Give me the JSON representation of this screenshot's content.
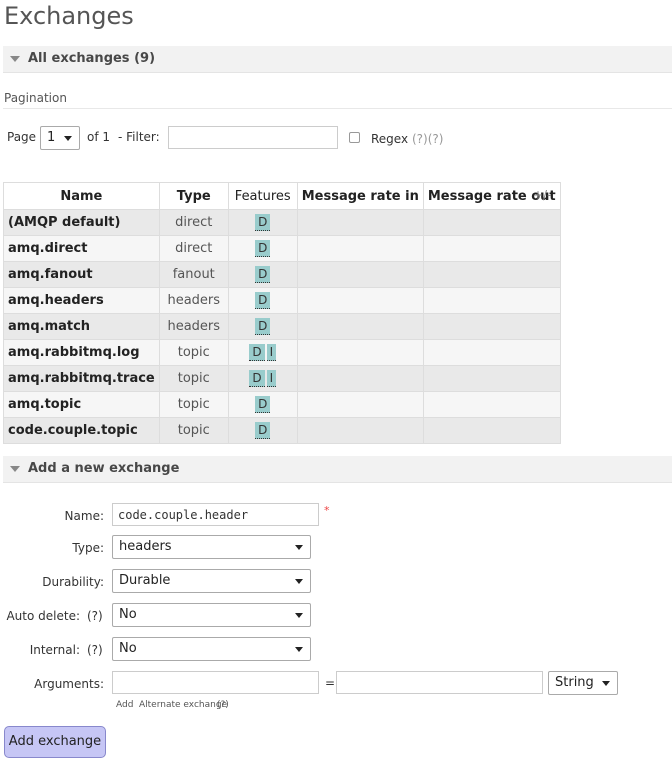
{
  "page_title": "Exchanges",
  "all_exchanges": {
    "label": "All exchanges (9)"
  },
  "pagination": {
    "label": "Pagination",
    "page_label": "Page",
    "page_value": "1",
    "of_label": "of 1",
    "filter_label": "- Filter:",
    "filter_value": "",
    "regex_label": "Regex",
    "regex_help": "(?)(?)",
    "regex_checked": false
  },
  "table": {
    "headers": [
      "Name",
      "Type",
      "Features",
      "Message rate in",
      "Message rate out"
    ],
    "column_toggle": "+/-",
    "rows": [
      {
        "name": "(AMQP default)",
        "type": "direct",
        "features": [
          "D"
        ],
        "rate_in": "",
        "rate_out": ""
      },
      {
        "name": "amq.direct",
        "type": "direct",
        "features": [
          "D"
        ],
        "rate_in": "",
        "rate_out": ""
      },
      {
        "name": "amq.fanout",
        "type": "fanout",
        "features": [
          "D"
        ],
        "rate_in": "",
        "rate_out": ""
      },
      {
        "name": "amq.headers",
        "type": "headers",
        "features": [
          "D"
        ],
        "rate_in": "",
        "rate_out": ""
      },
      {
        "name": "amq.match",
        "type": "headers",
        "features": [
          "D"
        ],
        "rate_in": "",
        "rate_out": ""
      },
      {
        "name": "amq.rabbitmq.log",
        "type": "topic",
        "features": [
          "D",
          "I"
        ],
        "rate_in": "",
        "rate_out": ""
      },
      {
        "name": "amq.rabbitmq.trace",
        "type": "topic",
        "features": [
          "D",
          "I"
        ],
        "rate_in": "",
        "rate_out": ""
      },
      {
        "name": "amq.topic",
        "type": "topic",
        "features": [
          "D"
        ],
        "rate_in": "",
        "rate_out": ""
      },
      {
        "name": "code.couple.topic",
        "type": "topic",
        "features": [
          "D"
        ],
        "rate_in": "",
        "rate_out": ""
      }
    ]
  },
  "add_exchange": {
    "section_label": "Add a new exchange",
    "name_label": "Name:",
    "name_value": "code.couple.header",
    "required_marker": "*",
    "type_label": "Type:",
    "type_value": "headers",
    "durability_label": "Durability:",
    "durability_value": "Durable",
    "auto_delete_label": "Auto delete:",
    "auto_delete_help": "(?)",
    "auto_delete_value": "No",
    "internal_label": "Internal:",
    "internal_help": "(?)",
    "internal_value": "No",
    "arguments_label": "Arguments:",
    "arguments_key": "",
    "arguments_equals": "=",
    "arguments_value": "",
    "arguments_type": "String",
    "add_link": "Add",
    "alternate_exchange_link": "Alternate exchange",
    "alternate_exchange_help": "(?)",
    "submit_label": "Add exchange"
  },
  "colors": {
    "feature_badge": "#99cccc",
    "row_odd": "#e9e9e9",
    "row_even": "#f6f6f6",
    "section_header": "#f2f2f2",
    "submit_button": "#c6c6f5",
    "required": "#ee4444"
  }
}
